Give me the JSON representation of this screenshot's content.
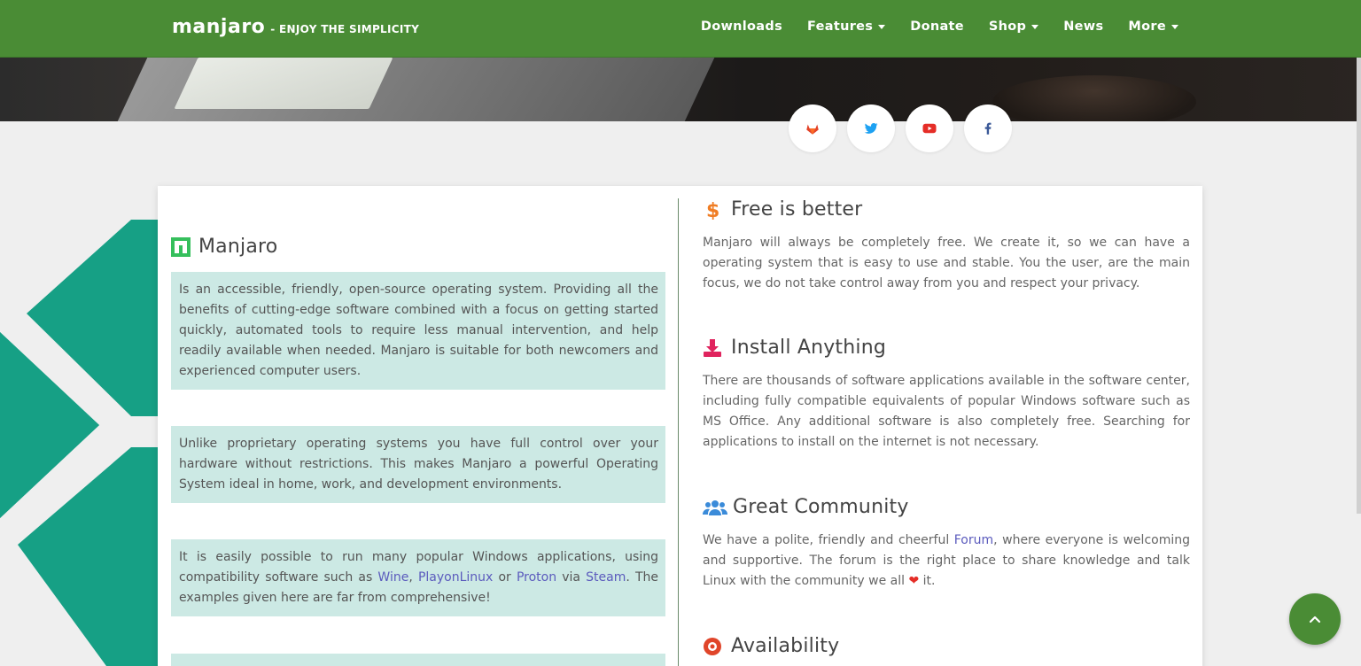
{
  "navbar": {
    "brand": "manjaro",
    "tagline": "- ENJOY THE SIMPLICITY",
    "items": [
      {
        "label": "Downloads",
        "dropdown": false
      },
      {
        "label": "Features",
        "dropdown": true
      },
      {
        "label": "Donate",
        "dropdown": false
      },
      {
        "label": "Shop",
        "dropdown": true
      },
      {
        "label": "News",
        "dropdown": false
      },
      {
        "label": "More",
        "dropdown": true
      }
    ]
  },
  "social": [
    {
      "icon": "gitlab-icon",
      "color": "#e24329"
    },
    {
      "icon": "twitter-icon",
      "color": "#1da1f2"
    },
    {
      "icon": "youtube-icon",
      "color": "#e52d27"
    },
    {
      "icon": "facebook-icon",
      "color": "#3b5998"
    }
  ],
  "left": {
    "title": "Manjaro",
    "box1": "Is an accessible, friendly, open-source operating system. Providing all the benefits of cutting-edge software combined with a focus on getting started quickly, automated tools to require less manual intervention, and help readily available when needed. Manjaro is suitable for both newcomers and experienced computer users.",
    "box2": "Unlike proprietary operating systems you have full control over your hardware without restrictions. This makes Manjaro a powerful Operating System ideal in home, work, and development environments.",
    "box3": {
      "before": "It is easily possible to run many popular Windows applications, using compatibility software such as ",
      "link_wine": "Wine",
      "comma": ", ",
      "link_playonlinux": "PlayonLinux",
      "or": " or ",
      "link_proton": "Proton",
      "via": " via ",
      "link_steam": "Steam",
      "after": ". The examples given here are far from comprehensive!"
    }
  },
  "right": {
    "free": {
      "title": "Free is better",
      "text": "Manjaro will always be completely free. We create it, so we can have a operating system that is easy to use and stable. You the user, are the main focus, we do not take control away from you and respect your privacy."
    },
    "install": {
      "title": "Install Anything",
      "text": "There are thousands of software applications available in the software center, including fully compatible equivalents of popular Windows software such as MS Office. Any additional software is also completely free. Searching for applications to install on the internet is not necessary."
    },
    "community": {
      "title": "Great Community",
      "text_before": "We have a polite, friendly and cheerful ",
      "link_forum": "Forum",
      "text_after": ", where everyone is welcoming and supportive. The forum is the right place to share knowledge and talk Linux with the community we all ",
      "heart": "❤",
      "text_end": " it."
    },
    "availability": {
      "title": "Availability"
    }
  },
  "colors": {
    "navbar": "#4a8c35",
    "teal": "#16a085",
    "box_bg": "#cce9e4",
    "link": "#5b5bbd"
  }
}
